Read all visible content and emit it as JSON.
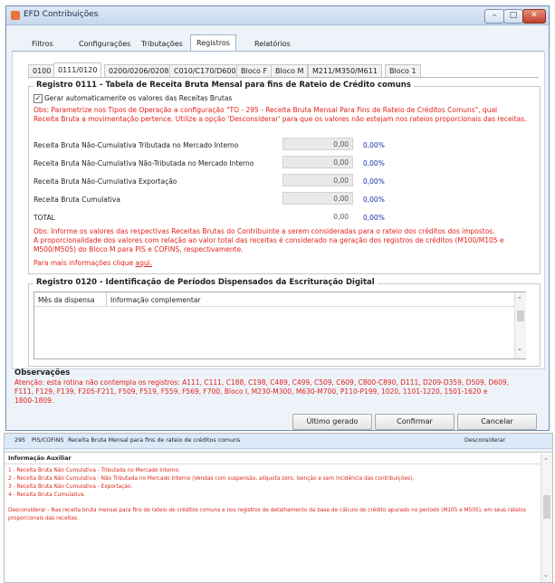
{
  "window": {
    "title": "EFD Contribuições",
    "min": "–",
    "max": "□",
    "close": "✕"
  },
  "top_tabs": [
    "Filtros",
    "Configurações",
    "Tributações",
    "Registros",
    "Relatórios"
  ],
  "sub_tabs": [
    "0100",
    "0111/0120",
    "0200/0206/0208",
    "C010/C170/D600",
    "Bloco F",
    "Bloco M",
    "M211/M350/M611",
    "Bloco 1"
  ],
  "reg0111": {
    "title": "Registro 0111 - Tabela de Receita Bruta Mensal para fins de Rateio de Crédito comuns",
    "checkbox_label": "Gerar automaticamente os valores das Receitas Brutas",
    "checkbox_mark": "✓",
    "obs1": [
      "Obs: Parametrize nos Tipos de Operação a configuração \"TO - 295 - Receita Bruta Mensal Para Fins de Rateio de Créditos Comuns\", qual",
      "Receita Bruta a movimentação pertence. Utilize a opção 'Desconsiderar' para que os valores não estejam nos rateios proporcionais das receitas."
    ],
    "rows": [
      {
        "label": "Receita Bruta Não-Cumulativa Tributada no Mercado Interno",
        "value": "0,00",
        "pct": "0,00%"
      },
      {
        "label": "Receita Bruta Não-Cumulativa Não-Tributada no Mercado Interno",
        "value": "0,00",
        "pct": "0,00%"
      },
      {
        "label": "Receita Bruta Não-Cumulativa Exportação",
        "value": "0,00",
        "pct": "0,00%"
      },
      {
        "label": "Receita Bruta Cumulativa",
        "value": "0,00",
        "pct": "0,00%"
      }
    ],
    "total": {
      "label": "TOTAL",
      "value": "0,00",
      "pct": "0,00%"
    },
    "obs2": [
      "Obs: Informe os valores das respectivas Receitas Brutas do Contribuinte a serem consideradas para o rateio dos créditos dos impostos.",
      "A proporcionalidade dos valores com relação ao valor total das receitas é considerado na geração dos registros de créditos (M100/M105 e",
      "M500/M505) do Bloco M para PIS e COFINS, respectivamente."
    ],
    "more_info": "Para mais informações clique",
    "more_info_link": "aqui."
  },
  "reg0120": {
    "title": "Registro 0120 - Identificação de Períodos Dispensados da Escrituração Digital",
    "columns": [
      "Mês da dispensa",
      "Informação complementar"
    ]
  },
  "observacoes": {
    "title": "Observações",
    "lines": [
      "Atenção: esta rotina não contempla os registros: A111, C111, C188, C198, C489, C499, C509, C609, C800-C890, D111, D209-D359, D509, D609,",
      "F111, F129, F139, F205-F211, F509, F519, F559, F569, F700, Bloco I, M230-M300, M630-M700, P110-P199, 1020, 1101-1220, 1501-1620 e",
      "1800-1809."
    ]
  },
  "buttons": {
    "ultimo": "Último gerado",
    "confirmar": "Confirmar",
    "cancelar": "Cancelar"
  },
  "lower": {
    "row": {
      "code": "295",
      "tax": "PIS/COFINS",
      "desc": "Receita Bruta Mensal para fins de rateio de créditos comuns",
      "action": "Desconsiderar"
    },
    "info_title": "Informação Auxiliar",
    "lines": [
      "1 - Receita Bruta Não Cumulativa - Tributada no Mercado Interno.",
      "2 - Receita Bruta Não Cumulativa - Não Tributada no Mercado Interno (Vendas com suspensão, alíquota zero, isenção e sem incidência das contribuições).",
      "3 - Receita Bruta Não Cumulativa - Exportação.",
      "4 - Receita Bruta Cumulativa."
    ],
    "desconsiderar": "Desconsiderar - Nas receita bruta mensal para fins de rateio de créditos comuns e nos registros de detalhamento da base de cálculo do crédito apurado no período (M105 e M505), em seus rateios proporcionais das receitas."
  }
}
